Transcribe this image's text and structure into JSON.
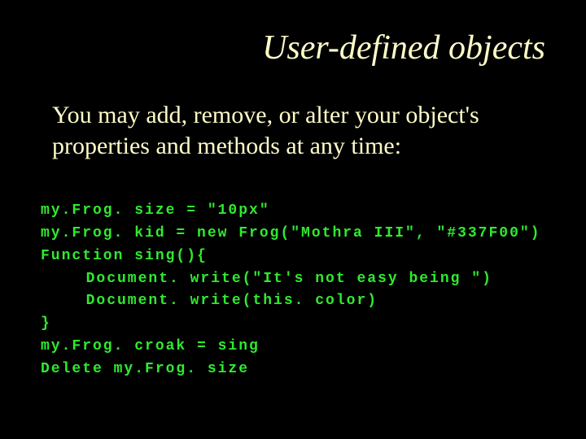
{
  "slide": {
    "title": "User-defined objects",
    "body": "You may add, remove, or alter your object's properties and methods at any time:",
    "code": {
      "lines": [
        "my.Frog. size = \"10px\"",
        "my.Frog. kid = new Frog(\"Mothra III\", \"#337F00\")",
        "Function sing(){",
        "  Document. write(\"It's not easy being \")",
        "  Document. write(this. color)",
        "}",
        "my.Frog. croak = sing",
        "Delete my.Frog. size"
      ]
    }
  }
}
